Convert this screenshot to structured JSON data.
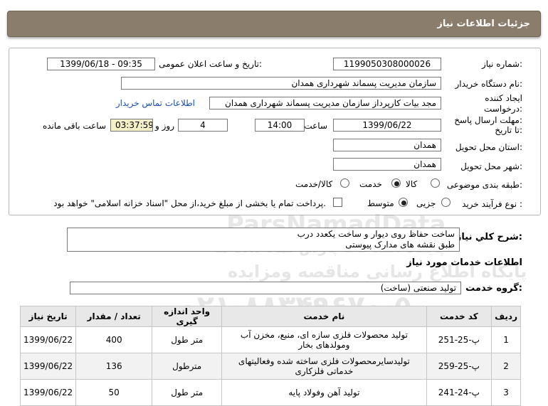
{
  "header": {
    "title": "جزئیات اطلاعات نیاز"
  },
  "form": {
    "need_number_label": "شماره نیاز:",
    "need_number": "1199050308000026",
    "announce_label": "تاریخ و ساعت اعلان عمومی:",
    "announce_value": "1399/06/18 - 09:35",
    "buyer_org_label": "نام دستگاه خریدار:",
    "buyer_org": "سازمان مدیریت پسماند شهرداری همدان",
    "creator_label_1": "ایجاد کننده",
    "creator_label_2": "درخواست:",
    "creator_value": "مجد بیات کارپرداز سازمان مدیریت پسماند شهرداری همدان",
    "contact_link": "اطلاعات تماس خریدار",
    "deadline_label_1": "مهلت ارسال پاسخ:",
    "deadline_label_2": "تا تاریخ:",
    "deadline_date": "1399/06/22",
    "time_label": "ساعت",
    "deadline_time": "14:00",
    "days_value": "4",
    "days_label": "روز و",
    "remaining_time": "03:37:59",
    "remaining_label": "ساعت باقی مانده",
    "province_label": "استان محل تحویل:",
    "province": "همدان",
    "city_label": "شهر محل تحویل:",
    "city": "همدان",
    "category_label": "طبقه بندی موضوعی:",
    "category_options": [
      "کالا",
      "خدمت",
      "کالا/خدمت"
    ],
    "category_selected": "خدمت",
    "process_label": "نوع فرآیند خرید :",
    "process_options": [
      "جزیی",
      "متوسط"
    ],
    "process_selected": "متوسط",
    "payment_note": "پرداخت تمام یا بخشی از مبلغ خرید،از محل \"اسناد خزانه اسلامی\" خواهد بود."
  },
  "description": {
    "label": "شرح كلي نياز:",
    "line1": "ساخت حفاظ روی دیوار و ساخت یکعدد درب",
    "line2": "طبق نقشه های مدارک پیوستی"
  },
  "services": {
    "section_title": "اطلاعات خدمات مورد نیاز",
    "group_label": "گروه خدمت:",
    "group_value": "تولید صنعتی (ساخت)",
    "columns": [
      "ردیف",
      "کد خدمت",
      "نام خدمت",
      "واحد اندازه گیری",
      "تعداد / مقدار",
      "تاریخ نیاز"
    ],
    "rows": [
      {
        "idx": "1",
        "code": "پ-25-251",
        "name": "تولید محصولات فلزی سازه ای، منبع، مخزن آب ومولدهای بخار",
        "unit": "متر طول",
        "qty": "400",
        "date": "1399/06/22"
      },
      {
        "idx": "2",
        "code": "پ-25-259",
        "name": "تولیدسایرمحصولات فلزی ساخته شده وفعالیتهای خدماتی فلزکاری",
        "unit": "مترطول",
        "qty": "136",
        "date": "1399/06/22"
      },
      {
        "idx": "3",
        "code": "پ-24-241",
        "name": "تولید آهن وفولاد پایه",
        "unit": "متر طول",
        "qty": "50",
        "date": "1399/06/22"
      }
    ]
  },
  "watermark": {
    "brand": "ParsNamadData",
    "line_fa_1": "پایگاه اطلاعات پارس نماد داده ها",
    "line_fa_2": "پایگاه اطلاع رسانی مناقصه ومزایده",
    "phone": "۰۲۱-۸۸۳۴۹۶۷۰-۵"
  }
}
